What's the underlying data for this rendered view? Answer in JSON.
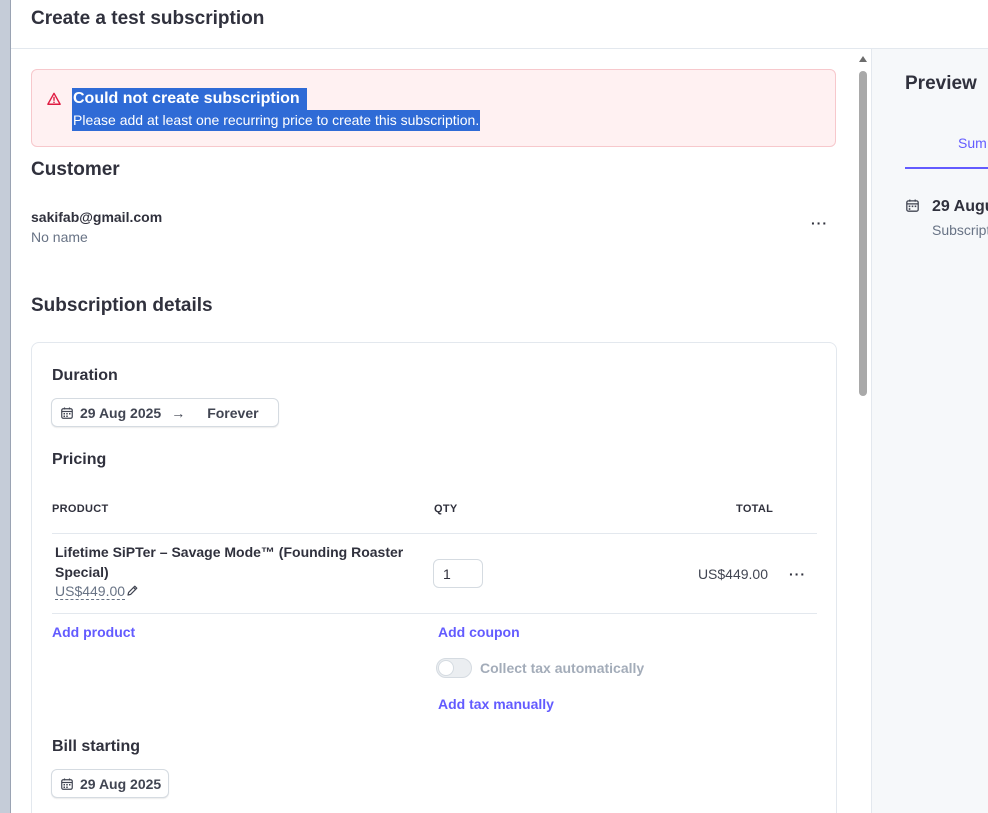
{
  "header": {
    "title": "Create a test subscription"
  },
  "alert": {
    "title": "Could not create subscription",
    "message": "Please add at least one recurring price to create this subscription."
  },
  "customer": {
    "section_title": "Customer",
    "email": "sakifab@gmail.com",
    "name": "No name",
    "more_label": "···"
  },
  "subscription": {
    "section_title": "Subscription details",
    "duration": {
      "label": "Duration",
      "start": "29 Aug 2025",
      "end": "Forever"
    },
    "pricing": {
      "label": "Pricing",
      "columns": {
        "product": "PRODUCT",
        "qty": "QTY",
        "total": "TOTAL"
      },
      "items": [
        {
          "product": "Lifetime SiPTer – Savage Mode™ (Founding Roaster Special)",
          "price": "US$449.00",
          "qty": "1",
          "total": "US$449.00"
        }
      ],
      "add_product": "Add product",
      "add_coupon": "Add coupon",
      "collect_tax": "Collect tax automatically",
      "collect_tax_enabled": false,
      "add_tax_manually": "Add tax manually"
    },
    "bill_starting": {
      "label": "Bill starting",
      "date": "29 Aug 2025"
    }
  },
  "preview": {
    "title": "Preview",
    "tab": "Sum",
    "date": "29 Augu",
    "subtitle": "Subscript"
  },
  "colors": {
    "accent": "#635bff",
    "error_bg": "#fff1f2",
    "selection": "#2f6bd6"
  }
}
